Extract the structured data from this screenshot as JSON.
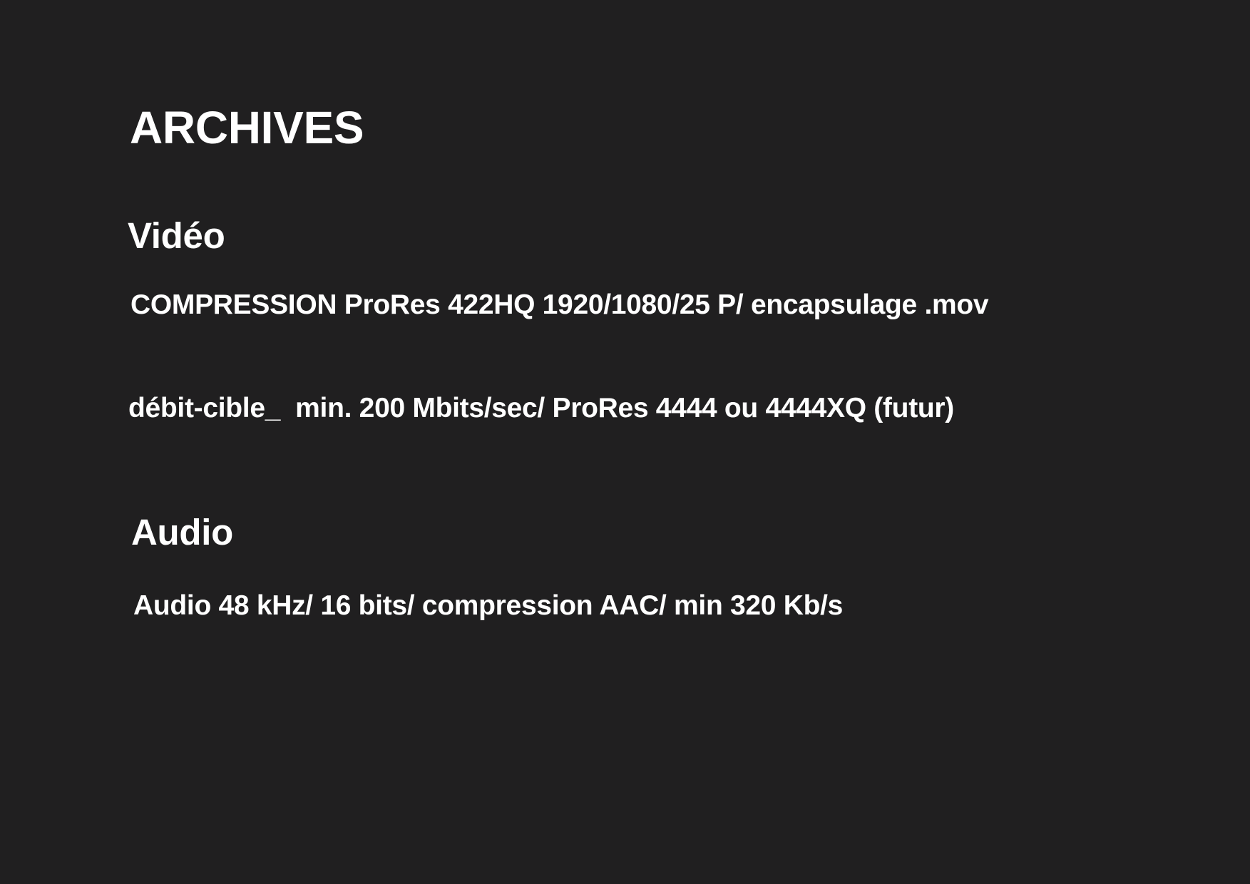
{
  "document": {
    "title": "ARCHIVES",
    "sections": [
      {
        "heading": "Vidéo",
        "lines": [
          "COMPRESSION ProRes 422HQ 1920/1080/25 P/ encapsulage .mov",
          "débit-cible_  min. 200 Mbits/sec/ ProRes 4444 ou 4444XQ (futur)"
        ]
      },
      {
        "heading": "Audio",
        "lines": [
          "Audio 48 kHz/ 16 bits/ compression AAC/ min 320 Kb/s"
        ]
      }
    ]
  },
  "colors": {
    "background": "#201f20",
    "text": "#ffffff"
  }
}
